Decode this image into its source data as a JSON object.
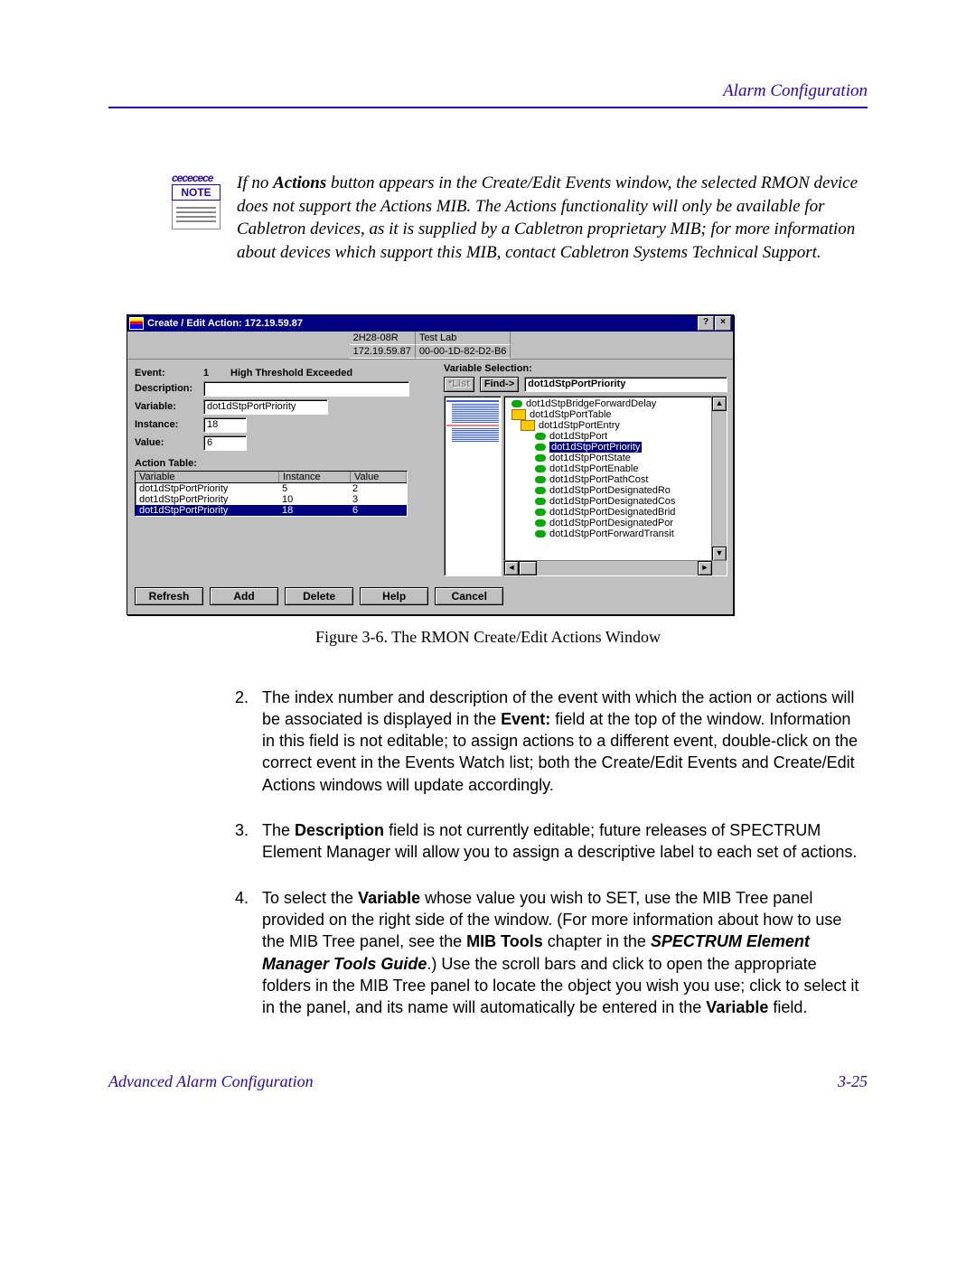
{
  "page_header": "Alarm Configuration",
  "note": {
    "label": "NOTE",
    "text_prefix": "If no ",
    "text_bold1": "Actions",
    "text_rest": " button appears in the Create/Edit Events window, the selected RMON device does not support the Actions MIB. The Actions functionality will only be available for Cabletron devices, as it is supplied by a Cabletron proprietary MIB; for more information about devices which support this MIB, contact Cabletron Systems Technical Support."
  },
  "dialog": {
    "title": "Create / Edit Action: 172.19.59.87",
    "help_btn": "?",
    "close_btn": "×",
    "info": {
      "device": "2H28-08R",
      "ip": "172.19.59.87",
      "loc": "Test Lab",
      "mac": "00-00-1D-82-D2-B6"
    },
    "fields": {
      "event_label": "Event:",
      "event_num": "1",
      "event_desc": "High Threshold Exceeded",
      "description_label": "Description:",
      "description_value": "",
      "variable_label": "Variable:",
      "variable_value": "dot1dStpPortPriority",
      "instance_label": "Instance:",
      "instance_value": "18",
      "value_label": "Value:",
      "value_value": "6",
      "action_table_label": "Action Table:"
    },
    "action_table": {
      "headers": {
        "var": "Variable",
        "inst": "Instance",
        "val": "Value"
      },
      "rows": [
        {
          "var": "dot1dStpPortPriority",
          "inst": "5",
          "val": "2",
          "sel": false
        },
        {
          "var": "dot1dStpPortPriority",
          "inst": "10",
          "val": "3",
          "sel": false
        },
        {
          "var": "dot1dStpPortPriority",
          "inst": "18",
          "val": "6",
          "sel": true
        }
      ]
    },
    "buttons": {
      "refresh": "Refresh",
      "add": "Add",
      "delete": "Delete",
      "help": "Help",
      "cancel": "Cancel"
    },
    "var_selection": {
      "label": "Variable Selection:",
      "list_btn": "*List",
      "find_btn": "Find->",
      "selected": "dot1dStpPortPriority",
      "tree": [
        {
          "lvl": 0,
          "type": "leaf",
          "name": "dot1dStpBridgeForwardDelay"
        },
        {
          "lvl": 0,
          "type": "folder",
          "name": "dot1dStpPortTable"
        },
        {
          "lvl": 1,
          "type": "folder",
          "name": "dot1dStpPortEntry"
        },
        {
          "lvl": 2,
          "type": "leaf",
          "name": "dot1dStpPort"
        },
        {
          "lvl": 2,
          "type": "leaf",
          "name": "dot1dStpPortPriority",
          "sel": true
        },
        {
          "lvl": 2,
          "type": "leaf",
          "name": "dot1dStpPortState"
        },
        {
          "lvl": 2,
          "type": "leaf",
          "name": "dot1dStpPortEnable"
        },
        {
          "lvl": 2,
          "type": "leaf",
          "name": "dot1dStpPortPathCost"
        },
        {
          "lvl": 2,
          "type": "leaf",
          "name": "dot1dStpPortDesignatedRo"
        },
        {
          "lvl": 2,
          "type": "leaf",
          "name": "dot1dStpPortDesignatedCos"
        },
        {
          "lvl": 2,
          "type": "leaf",
          "name": "dot1dStpPortDesignatedBrid"
        },
        {
          "lvl": 2,
          "type": "leaf",
          "name": "dot1dStpPortDesignatedPor"
        },
        {
          "lvl": 2,
          "type": "leaf",
          "name": "dot1dStpPortForwardTransit"
        }
      ]
    }
  },
  "figure_caption": "Figure 3-6. The RMON Create/Edit Actions Window",
  "list": {
    "item2": {
      "num": "2.",
      "t1": "The index number and description of the event with which the action or actions will be associated is displayed in the ",
      "b1": "Event:",
      "t2": " field at the top of the window. Information in this field is not editable; to assign actions to a different event, double-click on the correct event in the Events Watch list; both the Create/Edit Events and Create/Edit Actions windows will update accordingly."
    },
    "item3": {
      "num": "3.",
      "t1": "The ",
      "b1": "Description",
      "t2": " field is not currently editable; future releases of SPECTRUM Element Manager will allow you to assign a descriptive label to each set of actions."
    },
    "item4": {
      "num": "4.",
      "t1": "To select the ",
      "b1": "Variable",
      "t2": " whose value you wish to SET, use the MIB Tree panel provided on the right side of the window. (For more information about how to use the MIB Tree panel, see the ",
      "b2": "MIB Tools",
      "t3": " chapter in the ",
      "bi1": "SPECTRUM Element Manager Tools Guide",
      "t4": ".) Use the scroll bars and click to open the appropriate folders in the MIB Tree panel to locate the object you wish you use; click to select it in the panel, and its name will automatically be entered in the ",
      "b3": "Variable",
      "t5": " field."
    }
  },
  "footer": {
    "left": "Advanced Alarm Configuration",
    "right": "3-25"
  }
}
